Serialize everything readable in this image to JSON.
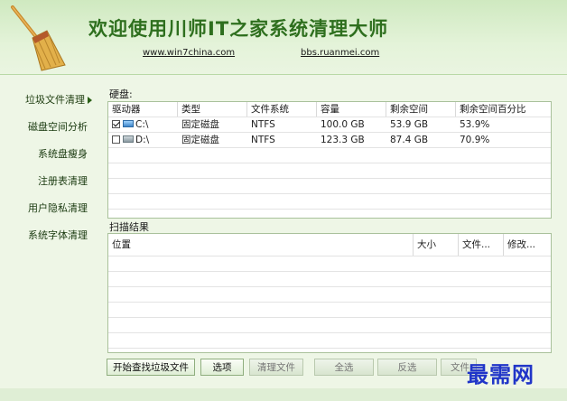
{
  "header": {
    "title": "欢迎使用川师IT之家系统清理大师",
    "link1": "www.win7china.com",
    "link2": "bbs.ruanmei.com"
  },
  "sidebar": {
    "items": [
      {
        "label": "垃圾文件清理",
        "active": true
      },
      {
        "label": "磁盘空间分析"
      },
      {
        "label": "系统盘瘦身"
      },
      {
        "label": "注册表清理"
      },
      {
        "label": "用户隐私清理"
      },
      {
        "label": "系统字体清理"
      }
    ]
  },
  "disk": {
    "label": "硬盘:",
    "columns": [
      "驱动器",
      "类型",
      "文件系统",
      "容量",
      "剩余空间",
      "剩余空间百分比"
    ],
    "rows": [
      {
        "drive": "C:\\",
        "type": "固定磁盘",
        "fs": "NTFS",
        "capacity": "100.0 GB",
        "free": "53.9 GB",
        "percent": "53.9%",
        "checked": true
      },
      {
        "drive": "D:\\",
        "type": "固定磁盘",
        "fs": "NTFS",
        "capacity": "123.3 GB",
        "free": "87.4 GB",
        "percent": "70.9%",
        "checked": false
      }
    ]
  },
  "scan": {
    "label": "扫描结果",
    "columns": [
      "位置",
      "大小",
      "文件...",
      "修改..."
    ]
  },
  "buttons": {
    "start": "开始查找垃圾文件",
    "options": "选项",
    "clean": "清理文件",
    "select_all": "全选",
    "invert": "反选",
    "file": "文件"
  },
  "watermark": "最需网",
  "colors": {
    "accent": "#2e6f1e",
    "watermark": "#2035c8"
  }
}
